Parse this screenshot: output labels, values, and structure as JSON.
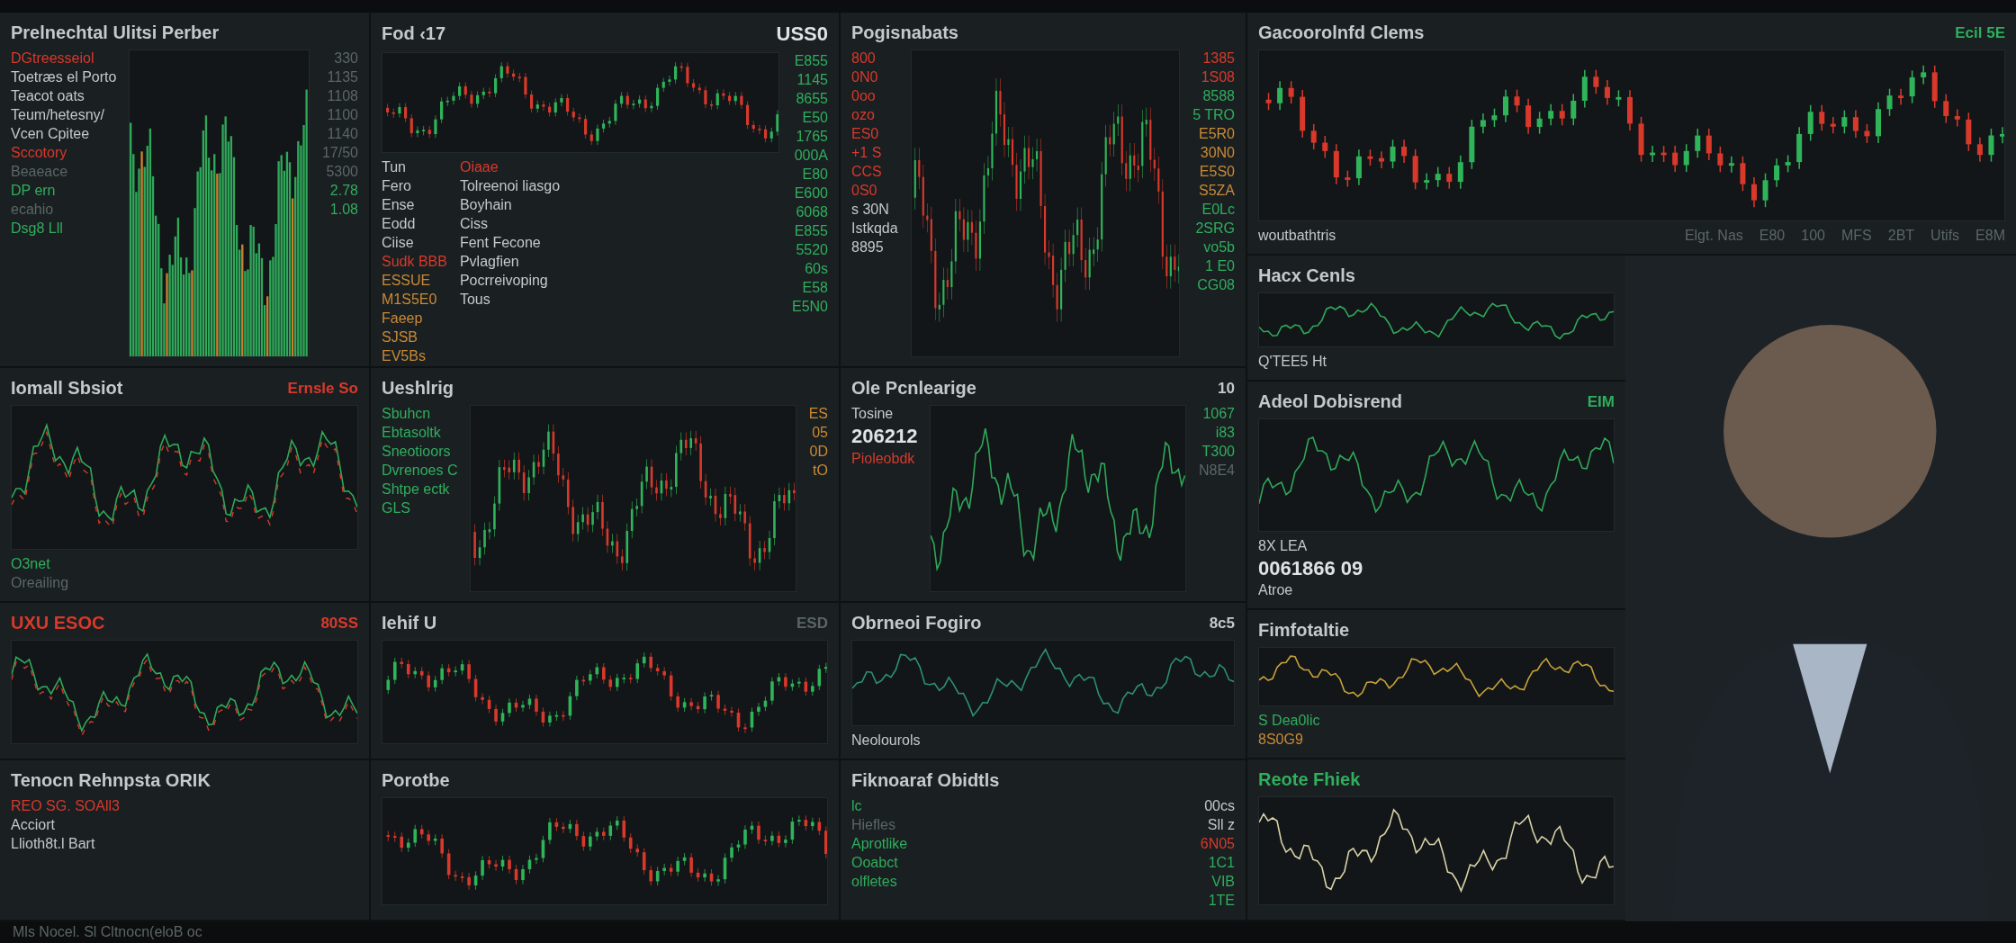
{
  "columns": [
    {
      "panels": [
        {
          "kind": "side",
          "title": {
            "text": "Prelnechtal Ulitsi Perber",
            "kind": "plain"
          },
          "chart": {
            "kind": "bars"
          },
          "lines": [
            {
              "text": "DGtreesseiol",
              "kind": "negative"
            },
            {
              "text": "Toetræs el Porto",
              "kind": "plain"
            },
            {
              "text": "Teacot oats",
              "kind": "plain"
            },
            {
              "text": "Teum/hetesny/",
              "kind": "plain"
            },
            {
              "text": "Vcen Cpitee",
              "kind": "plain"
            },
            {
              "text": "Sccotory",
              "kind": "negative"
            },
            {
              "text": "Beaeace",
              "kind": "muted"
            },
            {
              "text": "DP ern",
              "kind": "positive"
            },
            {
              "text": "ecahio",
              "kind": "muted"
            },
            {
              "text": "Dsg8 Lll",
              "kind": "positive"
            }
          ],
          "values": [
            {
              "text": "330",
              "kind": "muted"
            },
            {
              "text": "1135",
              "kind": "muted"
            },
            {
              "text": "1108",
              "kind": "muted"
            },
            {
              "text": "1100",
              "kind": "muted"
            },
            {
              "text": "1140",
              "kind": "muted"
            },
            {
              "text": "17/50",
              "kind": "muted"
            },
            {
              "text": "5300",
              "kind": "muted"
            },
            {
              "text": "2.78",
              "kind": "positive"
            },
            {
              "text": "1.08",
              "kind": "positive"
            }
          ]
        },
        {
          "kind": "stack",
          "title": {
            "text": "Iomall Sbsiot",
            "kind": "plain"
          },
          "tag": {
            "text": "Ernsle So",
            "kind": "negative"
          },
          "chart": {
            "kind": "dualline"
          },
          "lines": [
            {
              "text": "O3net",
              "kind": "positive"
            },
            {
              "text": "Oreailing",
              "kind": "muted"
            }
          ]
        },
        {
          "kind": "stack",
          "title": {
            "text": "UXU ESOC",
            "kind": "negative"
          },
          "tag": {
            "text": "80SS",
            "kind": "negative"
          },
          "chart": {
            "kind": "dualline"
          }
        },
        {
          "kind": "side",
          "title": {
            "text": "Tenocn Rehnpsta ORIK",
            "kind": "plain"
          },
          "lines": [
            {
              "text": "REO SG. SOAll3",
              "kind": "negative"
            },
            {
              "text": "Acciort",
              "kind": "plain"
            },
            {
              "text": "Llioth8t.l Bart",
              "kind": "plain"
            }
          ]
        }
      ]
    },
    {
      "panels": [
        {
          "kind": "stack",
          "title": {
            "text": "Fod ‹17",
            "kind": "plain"
          },
          "tag": {
            "text": "USS0",
            "kind": "bright"
          },
          "chart": {
            "kind": "candles"
          },
          "lines": [
            {
              "text": "Tun",
              "kind": "plain"
            },
            {
              "text": "Fero",
              "kind": "plain"
            },
            {
              "text": "Ense",
              "kind": "plain"
            },
            {
              "text": "Eodd",
              "kind": "plain"
            },
            {
              "text": "Ciise",
              "kind": "plain"
            },
            {
              "text": "Sudk BBB",
              "kind": "negative"
            },
            {
              "text": "ESSUE",
              "kind": "warning"
            },
            {
              "text": "M1S5E0",
              "kind": "warning"
            },
            {
              "text": "Faeep",
              "kind": "warning"
            },
            {
              "text": "SJSB",
              "kind": "warning"
            },
            {
              "text": "EV5Bs",
              "kind": "warning"
            }
          ],
          "lines2": [
            {
              "text": "Oiaae",
              "kind": "negative"
            },
            {
              "text": "Tolreenoi liasgo",
              "kind": "plain"
            },
            {
              "text": "Boyhain",
              "kind": "plain"
            },
            {
              "text": "Ciss",
              "kind": "plain"
            },
            {
              "text": "Fent Fecone",
              "kind": "plain"
            },
            {
              "text": "Pvlagfien",
              "kind": "plain"
            },
            {
              "text": "Pocrreivoping",
              "kind": "plain"
            },
            {
              "text": "Tous",
              "kind": "plain"
            }
          ],
          "values": [
            {
              "text": "E855",
              "kind": "positive"
            },
            {
              "text": "1145",
              "kind": "positive"
            },
            {
              "text": "8655",
              "kind": "positive"
            },
            {
              "text": "E50",
              "kind": "positive"
            },
            {
              "text": "1765",
              "kind": "positive"
            },
            {
              "text": "000A",
              "kind": "positive"
            },
            {
              "text": "E80",
              "kind": "positive"
            },
            {
              "text": "E600",
              "kind": "positive"
            },
            {
              "text": "6068",
              "kind": "positive"
            },
            {
              "text": "E855",
              "kind": "positive"
            },
            {
              "text": "5520",
              "kind": "positive"
            },
            {
              "text": "60s",
              "kind": "positive"
            },
            {
              "text": "E58",
              "kind": "positive"
            },
            {
              "text": "E5N0",
              "kind": "positive"
            }
          ]
        },
        {
          "kind": "side",
          "title": {
            "text": "Ueshlrig",
            "kind": "plain"
          },
          "chart": {
            "kind": "candles"
          },
          "lines": [
            {
              "text": "Sbuhcn",
              "kind": "positive"
            },
            {
              "text": "Ebtasoltk",
              "kind": "positive"
            },
            {
              "text": "Sneotioors",
              "kind": "positive"
            },
            {
              "text": "Dvrenoes C",
              "kind": "positive"
            },
            {
              "text": "Shtpe ectk",
              "kind": "positive"
            },
            {
              "text": "GLS",
              "kind": "positive"
            }
          ],
          "values": [
            {
              "text": "ES",
              "kind": "warning"
            },
            {
              "text": "05",
              "kind": "warning"
            },
            {
              "text": "0D",
              "kind": "warning"
            },
            {
              "text": "tO",
              "kind": "warning"
            }
          ]
        },
        {
          "kind": "stack",
          "title": {
            "text": "Iehif U",
            "kind": "plain"
          },
          "tag": {
            "text": "ESD",
            "kind": "muted"
          },
          "chart": {
            "kind": "candles"
          }
        },
        {
          "kind": "stack",
          "title": {
            "text": "Porotbe",
            "kind": "plain"
          },
          "chart": {
            "kind": "candles"
          }
        }
      ]
    },
    {
      "panels": [
        {
          "kind": "side",
          "title": {
            "text": "Pogisnabats",
            "kind": "plain"
          },
          "chart": {
            "kind": "candles"
          },
          "lines": [
            {
              "text": "800",
              "kind": "negative"
            },
            {
              "text": "0N0",
              "kind": "negative"
            },
            {
              "text": "0oo",
              "kind": "negative"
            },
            {
              "text": "ozo",
              "kind": "negative"
            },
            {
              "text": "ES0",
              "kind": "negative"
            },
            {
              "text": "+1 S",
              "kind": "negative"
            },
            {
              "text": "CCS",
              "kind": "negative"
            },
            {
              "text": "0S0",
              "kind": "negative"
            },
            {
              "text": "s 30N",
              "kind": "plain"
            },
            {
              "text": "Istkqda",
              "kind": "plain"
            },
            {
              "text": "8895",
              "kind": "plain"
            }
          ],
          "values": [
            {
              "text": "1385",
              "kind": "negative"
            },
            {
              "text": "1S08",
              "kind": "negative"
            },
            {
              "text": "8588",
              "kind": "positive"
            },
            {
              "text": "5 TRO",
              "kind": "positive"
            },
            {
              "text": "E5R0",
              "kind": "warning"
            },
            {
              "text": "30N0",
              "kind": "warning"
            },
            {
              "text": "E5S0",
              "kind": "warning"
            },
            {
              "text": "S5ZA",
              "kind": "warning"
            },
            {
              "text": "E0Lc",
              "kind": "positive"
            },
            {
              "text": "2SRG",
              "kind": "positive"
            },
            {
              "text": "vo5b",
              "kind": "positive"
            },
            {
              "text": "1 E0",
              "kind": "positive"
            },
            {
              "text": "CG08",
              "kind": "positive"
            }
          ]
        },
        {
          "kind": "side",
          "title": {
            "text": "Ole Pcnlearige",
            "kind": "plain"
          },
          "tag": {
            "text": "10",
            "kind": "plain"
          },
          "chart": {
            "kind": "greenline"
          },
          "lines": [
            {
              "text": "Tosine",
              "kind": "plain"
            },
            {
              "text": "206212",
              "kind": "bright"
            },
            {
              "text": "Pioleobdk",
              "kind": "negative"
            }
          ],
          "values": [
            {
              "text": "1067",
              "kind": "positive"
            },
            {
              "text": "i83",
              "kind": "positive"
            },
            {
              "text": "T300",
              "kind": "positive"
            },
            {
              "text": "N8E4",
              "kind": "muted"
            }
          ]
        },
        {
          "kind": "stack",
          "title": {
            "text": "Obrneoi Fogiro",
            "kind": "plain"
          },
          "tag": {
            "text": "8c5",
            "kind": "plain"
          },
          "chart": {
            "kind": "tealline"
          },
          "lines": [
            {
              "text": "Neolourols",
              "kind": "plain"
            }
          ]
        },
        {
          "kind": "side",
          "title": {
            "text": "Fiknoaraf Obidtls",
            "kind": "plain"
          },
          "lines": [
            {
              "text": "lc",
              "kind": "positive"
            },
            {
              "text": "Hiefles",
              "kind": "muted"
            },
            {
              "text": "Aprotlike",
              "kind": "positive"
            },
            {
              "text": "Ooabct",
              "kind": "positive"
            },
            {
              "text": "olfletes",
              "kind": "positive"
            }
          ],
          "values": [
            {
              "text": "00cs",
              "kind": "plain"
            },
            {
              "text": "Sll z",
              "kind": "plain"
            },
            {
              "text": "6N05",
              "kind": "negative"
            },
            {
              "text": "1C1",
              "kind": "positive"
            },
            {
              "text": "VIB",
              "kind": "positive"
            },
            {
              "text": "1TE",
              "kind": "positive"
            }
          ]
        }
      ]
    }
  ],
  "right_area": {
    "top_panel": {
      "kind": "axis",
      "title": {
        "text": "Gacoorolnfd Clems",
        "kind": "plain"
      },
      "tag": {
        "text": "Ecil 5E",
        "kind": "positive"
      },
      "chart": {
        "kind": "candles"
      },
      "lines": [
        {
          "text": "woutbathtris",
          "kind": "plain"
        }
      ],
      "values": [
        {
          "text": "Elgt. Nas",
          "kind": "muted"
        },
        {
          "text": "E80",
          "kind": "muted"
        },
        {
          "text": "100",
          "kind": "muted"
        },
        {
          "text": "MFS",
          "kind": "muted"
        },
        {
          "text": "2BT",
          "kind": "muted"
        },
        {
          "text": "Utifs",
          "kind": "muted"
        },
        {
          "text": "E8M",
          "kind": "muted"
        }
      ]
    },
    "stack": [
      {
        "kind": "stack",
        "title": {
          "text": "Hacx Cenls",
          "kind": "plain"
        },
        "chart": {
          "kind": "greenline"
        },
        "lines": [
          {
            "text": "Q'TEE5 Ht",
            "kind": "plain"
          }
        ]
      },
      {
        "kind": "stack",
        "title": {
          "text": "Adeol Dobisrend",
          "kind": "plain"
        },
        "tag": {
          "text": "EIM",
          "kind": "positive"
        },
        "chart": {
          "kind": "greenline"
        },
        "lines": [
          {
            "text": "8X LEA",
            "kind": "plain"
          },
          {
            "text": "0061866 09",
            "kind": "bright"
          },
          {
            "text": "Atroe",
            "kind": "plain"
          }
        ]
      },
      {
        "kind": "stack",
        "title": {
          "text": "Fimfotaltie",
          "kind": "plain"
        },
        "chart": {
          "kind": "goldline"
        },
        "lines": [
          {
            "text": "S Dea0lic",
            "kind": "positive"
          },
          {
            "text": "8S0G9",
            "kind": "warning"
          }
        ]
      },
      {
        "kind": "stack",
        "title": {
          "text": "Reote Fhiek",
          "kind": "positive"
        },
        "chart": {
          "kind": "paleline"
        }
      }
    ]
  },
  "ticker": {
    "text": "Mls Nocel. Sl Cltnocn(eloB oc"
  }
}
